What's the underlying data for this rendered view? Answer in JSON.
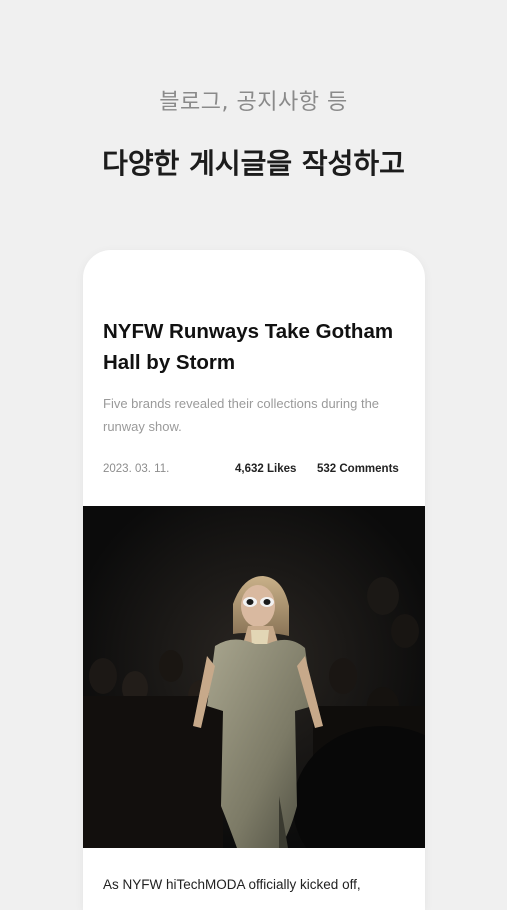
{
  "promo": {
    "subtitle": "블로그, 공지사항 등",
    "title": "다양한 게시글을 작성하고"
  },
  "post": {
    "title": "NYFW Runways Take Gotham Hall by Storm",
    "summary": "Five brands revealed their collections during the runway show.",
    "date": "2023. 03. 11.",
    "likes": "4,632 Likes",
    "comments": "532 Comments",
    "hero_image": "runway-model-photo",
    "body_first_line": "As NYFW hiTechMODA officially kicked off,"
  },
  "colors": {
    "background": "#f0f0f0",
    "card": "#ffffff",
    "title_text": "#111111",
    "muted_text": "#9a9a9a"
  }
}
